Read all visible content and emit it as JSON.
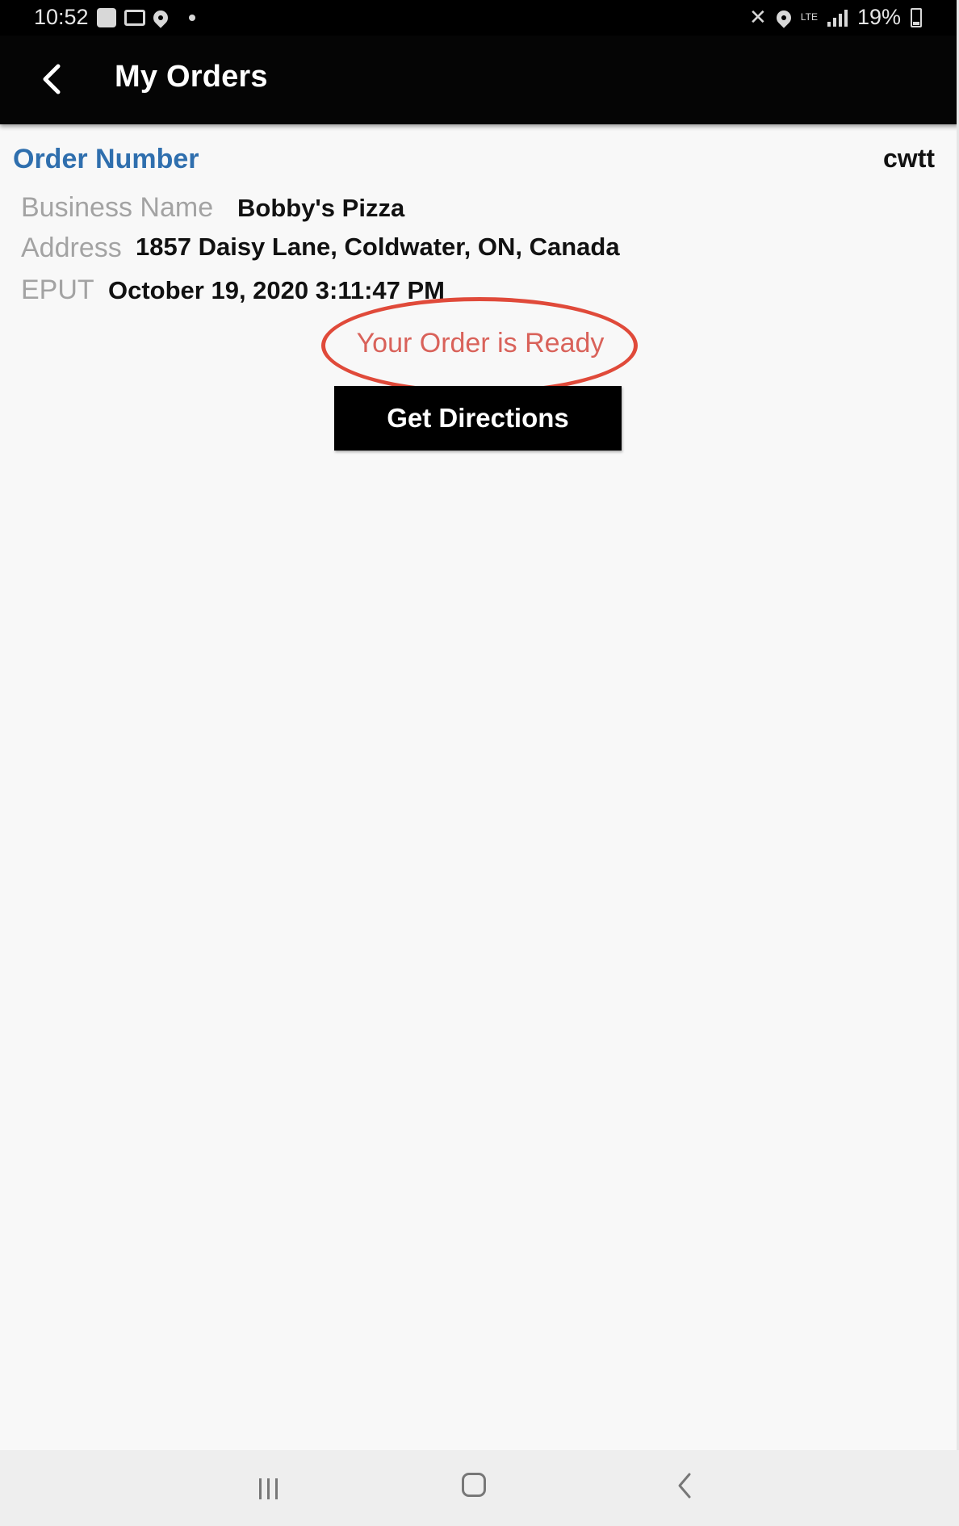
{
  "status_bar": {
    "time": "10:52",
    "battery": "19%",
    "network": "LTE"
  },
  "app_bar": {
    "title": "My Orders",
    "back_icon": "back-arrow-icon"
  },
  "order": {
    "number_label": "Order Number",
    "number_value": "cwtt",
    "business_label": "Business Name",
    "business_value": "Bobby's Pizza",
    "address_label": "Address",
    "address_value": "1857 Daisy Lane, Coldwater, ON, Canada",
    "eput_label": "EPUT",
    "eput_value": "October 19, 2020 3:11:47 PM",
    "status": "Your Order is Ready",
    "directions_button": "Get Directions"
  },
  "colors": {
    "accent_blue": "#2f6fae",
    "status_red": "#d9625a",
    "highlight_red": "#e04a3a",
    "bar_black": "#050505"
  },
  "nav_bar": {
    "icons": [
      "recents-icon",
      "home-icon",
      "back-icon"
    ]
  }
}
